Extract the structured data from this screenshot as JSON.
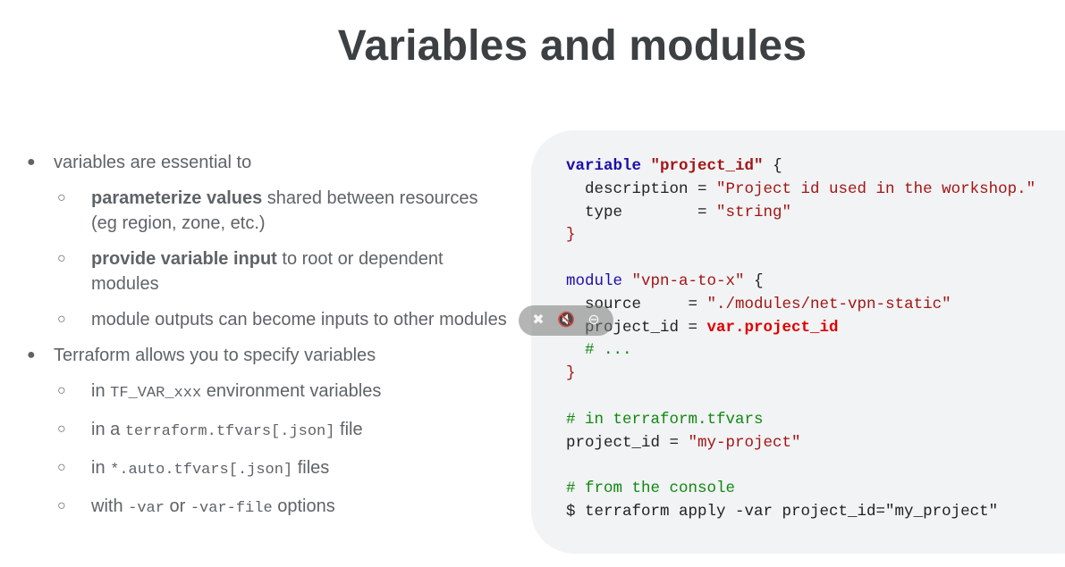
{
  "slide": {
    "title": "Variables and modules"
  },
  "bullets": {
    "b1_text": "variables are essential to",
    "b1_sub1_bold": "parameterize values",
    "b1_sub1_rest": " shared between resources (eg region, zone, etc.)",
    "b1_sub2_bold": "provide variable input",
    "b1_sub2_rest": " to root or dependent modules",
    "b1_sub3_text": "module outputs can become inputs to other modules",
    "b2_text": "Terraform allows you to specify variables",
    "b2_sub1_pre": "in ",
    "b2_sub1_code": "TF_VAR_xxx",
    "b2_sub1_post": " environment variables",
    "b2_sub2_pre": "in a ",
    "b2_sub2_code": "terraform.tfvars[.json]",
    "b2_sub2_post": " file",
    "b2_sub3_pre": "in ",
    "b2_sub3_code": "*.auto.tfvars[.json]",
    "b2_sub3_post": " files",
    "b2_sub4_pre": "with ",
    "b2_sub4_code1": "-var",
    "b2_sub4_mid": " or ",
    "b2_sub4_code2": "-var-file",
    "b2_sub4_post": " options"
  },
  "code": {
    "l1_kw": "variable",
    "l1_name": "\"project_id\"",
    "l1_rest": " {",
    "l2_key": "  description = ",
    "l2_val": "\"Project id used in the workshop.\"",
    "l3_key": "  type        = ",
    "l3_val": "\"string\"",
    "l4": "}",
    "l6_kw": "module",
    "l6_name": "\"vpn-a-to-x\"",
    "l6_rest": " {",
    "l7_key": "  source     = ",
    "l7_val": "\"./modules/net-vpn-static\"",
    "l8_key": "  project_id = ",
    "l8_val": "var.project_id",
    "l9": "  # ...",
    "l10": "}",
    "l12": "# in terraform.tfvars",
    "l13_key": "project_id = ",
    "l13_val": "\"my-project\"",
    "l15": "# from the console",
    "l16": "$ terraform apply -var project_id=\"my_project\""
  },
  "overlay": {
    "icon1": "pin-off-icon",
    "icon2": "mute-icon",
    "icon3": "minus-circle-icon",
    "glyph1": "✖",
    "glyph2": "🔇",
    "glyph3": "⊖"
  }
}
